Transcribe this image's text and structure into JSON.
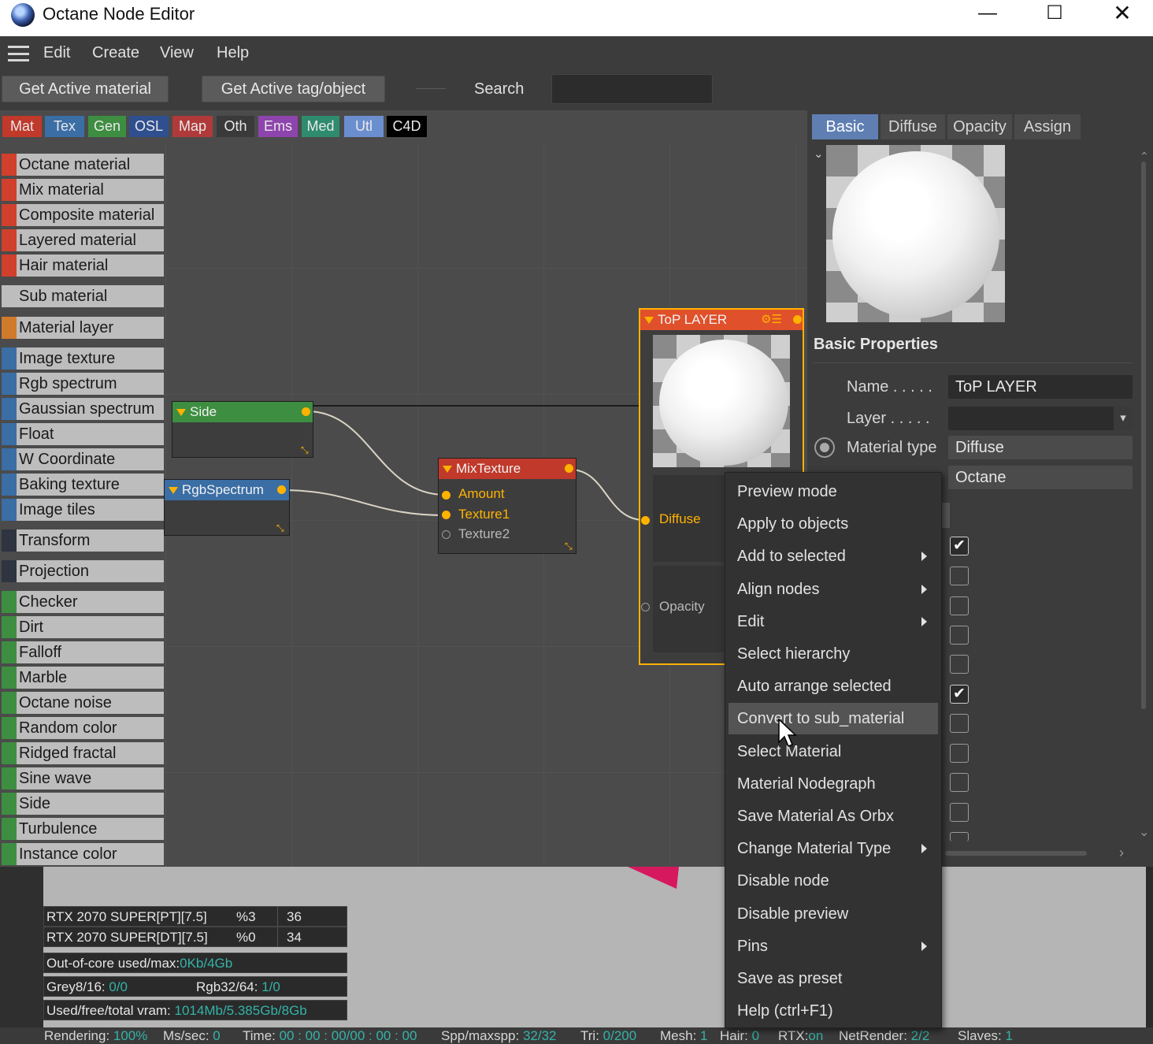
{
  "title": "Octane Node Editor",
  "window_controls": {
    "minimize": "—",
    "maximize": "☐",
    "close": "✕"
  },
  "menu": [
    "Edit",
    "Create",
    "View",
    "Help"
  ],
  "toolbar": {
    "get_active_material": "Get Active material",
    "get_active_tag": "Get Active tag/object",
    "search_label": "Search"
  },
  "categories": [
    {
      "label": "Mat",
      "color": "#c0392b"
    },
    {
      "label": "Tex",
      "color": "#3a6ea5"
    },
    {
      "label": "Gen",
      "color": "#3e8e41"
    },
    {
      "label": "OSL",
      "color": "#2f4f8f"
    },
    {
      "label": "Map",
      "color": "#b03a3a"
    },
    {
      "label": "Oth",
      "color": "#3a3a3a"
    },
    {
      "label": "Ems",
      "color": "#8e44ad"
    },
    {
      "label": "Med",
      "color": "#2e8b6e"
    },
    {
      "label": "Utl",
      "color": "#6b8ecf"
    },
    {
      "label": "C4D",
      "color": "#000000"
    }
  ],
  "node_list": [
    {
      "label": "Octane material",
      "color": "#d0402c"
    },
    {
      "label": "Mix material",
      "color": "#d0402c"
    },
    {
      "label": "Composite material",
      "color": "#d0402c"
    },
    {
      "label": "Layered material",
      "color": "#d0402c"
    },
    {
      "label": "Hair material",
      "color": "#d0402c"
    },
    {
      "label": "Sub material",
      "color": "#bdbdbd"
    },
    {
      "label": "Material layer",
      "color": "#d07a2c"
    },
    {
      "label": "Image texture",
      "color": "#3a6ea5"
    },
    {
      "label": "Rgb spectrum",
      "color": "#3a6ea5"
    },
    {
      "label": "Gaussian spectrum",
      "color": "#3a6ea5"
    },
    {
      "label": "Float",
      "color": "#3a6ea5"
    },
    {
      "label": "W Coordinate",
      "color": "#3a6ea5"
    },
    {
      "label": "Baking texture",
      "color": "#3a6ea5"
    },
    {
      "label": "Image tiles",
      "color": "#3a6ea5"
    },
    {
      "label": "Transform",
      "color": "#2e3440"
    },
    {
      "label": "Projection",
      "color": "#2e3440"
    },
    {
      "label": "Checker",
      "color": "#3e8e41"
    },
    {
      "label": "Dirt",
      "color": "#3e8e41"
    },
    {
      "label": "Falloff",
      "color": "#3e8e41"
    },
    {
      "label": "Marble",
      "color": "#3e8e41"
    },
    {
      "label": "Octane noise",
      "color": "#3e8e41"
    },
    {
      "label": "Random color",
      "color": "#3e8e41"
    },
    {
      "label": "Ridged fractal",
      "color": "#3e8e41"
    },
    {
      "label": "Sine wave",
      "color": "#3e8e41"
    },
    {
      "label": "Side",
      "color": "#3e8e41"
    },
    {
      "label": "Turbulence",
      "color": "#3e8e41"
    },
    {
      "label": "Instance color",
      "color": "#3e8e41"
    }
  ],
  "graph": {
    "side_node": {
      "title": "Side",
      "color": "#3e8e41"
    },
    "rgb_node": {
      "title": "RgbSpectrum",
      "color": "#3a6ea5"
    },
    "mix_node": {
      "title": "MixTexture",
      "color": "#c0392b",
      "ports": [
        "Amount",
        "Texture1",
        "Texture2"
      ]
    },
    "top_node": {
      "title": "ToP LAYER",
      "color": "#e0502a",
      "ports": [
        "Diffuse",
        "Opacity"
      ]
    }
  },
  "right_tabs": [
    "Basic",
    "Diffuse",
    "Opacity",
    "Assign"
  ],
  "basic_properties": {
    "title": "Basic Properties",
    "name_label": "Name . . . . .",
    "name_value": "ToP LAYER",
    "layer_label": "Layer . . . . .",
    "layer_value": "",
    "material_type_label": "Material type",
    "material_type_value": "Diffuse",
    "renderer_value": "Octane"
  },
  "checkboxes": [
    true,
    false,
    false,
    false,
    false,
    true,
    false,
    false,
    false,
    false
  ],
  "context_menu": [
    {
      "label": "Preview mode",
      "submenu": false
    },
    {
      "label": "Apply to objects",
      "submenu": false
    },
    {
      "label": "Add to selected",
      "submenu": true
    },
    {
      "label": "Align nodes",
      "submenu": true
    },
    {
      "label": "Edit",
      "submenu": true
    },
    {
      "label": "Select hierarchy",
      "submenu": false
    },
    {
      "label": "Auto arrange selected",
      "submenu": false
    },
    {
      "label": "Convert to sub_material",
      "submenu": false,
      "highlighted": true
    },
    {
      "label": "Select Material",
      "submenu": false
    },
    {
      "label": "Material Nodegraph",
      "submenu": false
    },
    {
      "label": "Save Material As Orbx",
      "submenu": false
    },
    {
      "label": "Change Material Type",
      "submenu": true
    },
    {
      "label": "Disable node",
      "submenu": false
    },
    {
      "label": "Disable preview",
      "submenu": false
    },
    {
      "label": "Pins",
      "submenu": true
    },
    {
      "label": "Save as preset",
      "submenu": false
    },
    {
      "label": "Help (ctrl+F1)",
      "submenu": false
    }
  ],
  "stats": {
    "gpu1": {
      "name": "RTX 2070 SUPER[PT][7.5]",
      "pct": "%3",
      "val": "36"
    },
    "gpu2": {
      "name": "RTX 2070 SUPER[DT][7.5]",
      "pct": "%0",
      "val": "34"
    },
    "ooc_label": "Out-of-core used/max:",
    "ooc_value": "0Kb/4Gb",
    "grey_label": "Grey8/16: ",
    "grey_value": "0/0",
    "rgb_label": "Rgb32/64: ",
    "rgb_value": "1/0",
    "vram_label": "Used/free/total vram: ",
    "vram_value": "1014Mb/5.385Gb/8Gb"
  },
  "status": {
    "rendering_label": "Rendering: ",
    "rendering": "100%",
    "mssec_label": "Ms/sec: ",
    "mssec": "0",
    "time_label": "Time: ",
    "time": "00 : 00 : 00/00 : 00 : 00",
    "spp_label": "Spp/maxspp: ",
    "spp": "32/32",
    "tri_label": "Tri: ",
    "tri": "0/200",
    "mesh_label": "Mesh: ",
    "mesh": "1",
    "hair_label": "Hair: ",
    "hair": "0",
    "rtx_label": "RTX:",
    "rtx": "on",
    "net_label": "NetRender: ",
    "net": "2/2",
    "slaves_label": "Slaves: ",
    "slaves": "1"
  }
}
